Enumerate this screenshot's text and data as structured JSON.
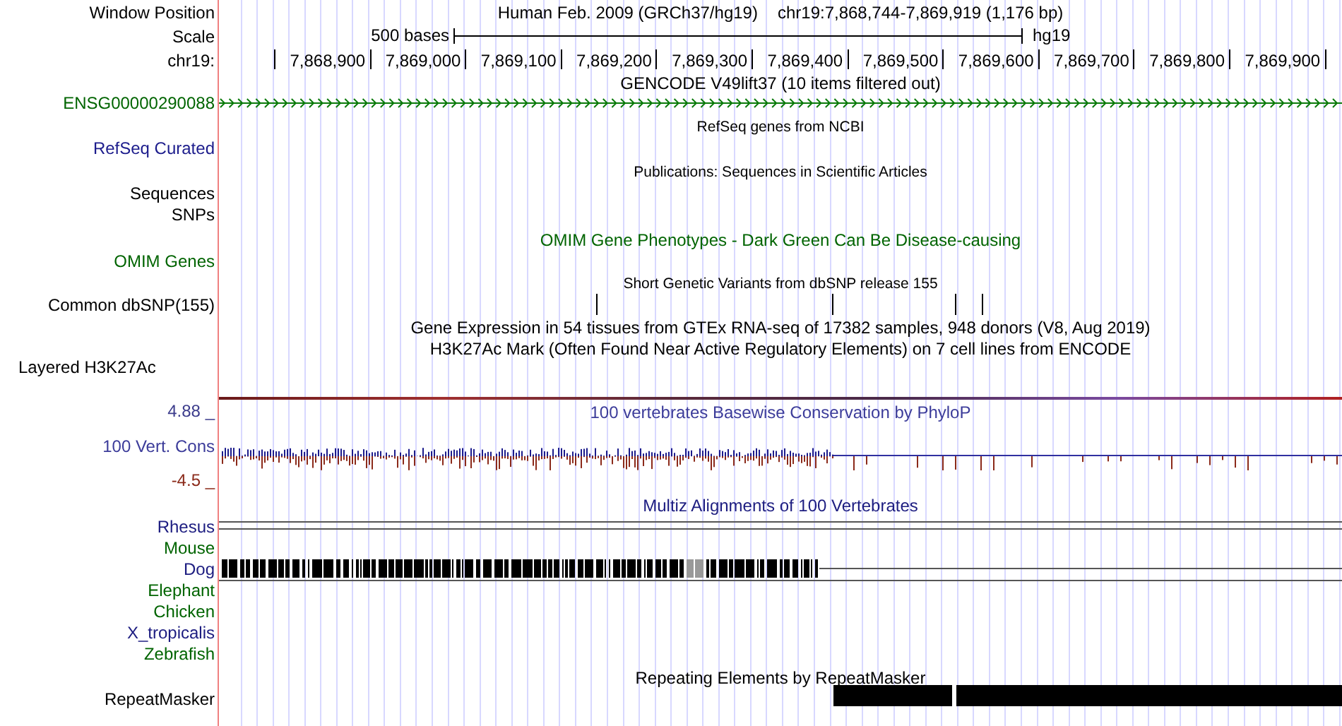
{
  "window_position": {
    "label": "Window Position",
    "assembly": "Human Feb. 2009 (GRCh37/hg19)",
    "range": "chr19:7,868,744-7,869,919 (1,176 bp)"
  },
  "scale": {
    "label": "Scale",
    "length": "500 bases",
    "assembly": "hg19"
  },
  "ruler": {
    "label": "chr19:",
    "ticks": [
      "7,868,900",
      "7,869,000",
      "7,869,100",
      "7,869,200",
      "7,869,300",
      "7,869,400",
      "7,869,500",
      "7,869,600",
      "7,869,700",
      "7,869,800",
      "7,869,900"
    ]
  },
  "tracks": [
    {
      "kind": "gene",
      "title": "GENCODE V49lift37 (10 items filtered out)",
      "color": "#000000",
      "labels": [
        {
          "text": "ENSG00000290088",
          "color": "#006400"
        }
      ]
    },
    {
      "kind": "note",
      "title": "RefSeq genes from NCBI",
      "color": "#000000",
      "labels": [
        {
          "text": "RefSeq Curated",
          "color": "#1c1c8c"
        }
      ]
    },
    {
      "kind": "note",
      "title": "Publications: Sequences in Scientific Articles",
      "color": "#000000",
      "labels": [
        {
          "text": "Sequences",
          "color": "#000000"
        },
        {
          "text": "SNPs",
          "color": "#000000"
        }
      ]
    },
    {
      "kind": "heading",
      "title": "OMIM Gene Phenotypes - Dark Green Can Be Disease-causing",
      "color": "#006400",
      "labels": [
        {
          "text": "OMIM Genes",
          "color": "#006400"
        }
      ]
    },
    {
      "kind": "variants",
      "title": "Short Genetic Variants from dbSNP release 155",
      "color": "#000000",
      "labels": [
        {
          "text": "Common dbSNP(155)",
          "color": "#000000"
        }
      ]
    },
    {
      "kind": "heading",
      "title": "Gene Expression in 54 tissues from GTEx RNA-seq of 17382 samples, 948 donors (V8, Aug 2019)",
      "color": "#000000"
    },
    {
      "kind": "signal",
      "title": "H3K27Ac Mark (Often Found Near Active Regulatory Elements) on 7 cell lines from ENCODE",
      "color": "#000000",
      "labels": [
        {
          "text": "Layered H3K27Ac",
          "color": "#000000"
        }
      ]
    },
    {
      "kind": "wiggle",
      "title": "100 vertebrates Basewise Conservation by PhyloP",
      "color": "#3c3c9a",
      "labels": [
        {
          "text": "4.88 _",
          "color": "#3c3c8c"
        },
        {
          "text": "100 Vert. Cons",
          "color": "#3c3c9a"
        },
        {
          "text": "-4.5 _",
          "color": "#8b2a1a"
        }
      ]
    },
    {
      "kind": "alignment",
      "title": "Multiz Alignments of 100 Vertebrates",
      "color": "#1c1c80",
      "species": [
        {
          "name": "Rhesus",
          "color": "#1c1c80",
          "kind": "double_line"
        },
        {
          "name": "Mouse",
          "color": "#006400",
          "kind": "empty"
        },
        {
          "name": "Dog",
          "color": "#1c1c80",
          "kind": "blocks"
        },
        {
          "name": "Elephant",
          "color": "#006400",
          "kind": "line"
        },
        {
          "name": "Chicken",
          "color": "#006400",
          "kind": "empty"
        },
        {
          "name": "X_tropicalis",
          "color": "#1c1c80",
          "kind": "empty"
        },
        {
          "name": "Zebrafish",
          "color": "#006400",
          "kind": "empty"
        }
      ]
    },
    {
      "kind": "repeats",
      "title": "Repeating Elements by RepeatMasker",
      "color": "#000000",
      "labels": [
        {
          "text": "RepeatMasker",
          "color": "#000000"
        }
      ]
    }
  ]
}
